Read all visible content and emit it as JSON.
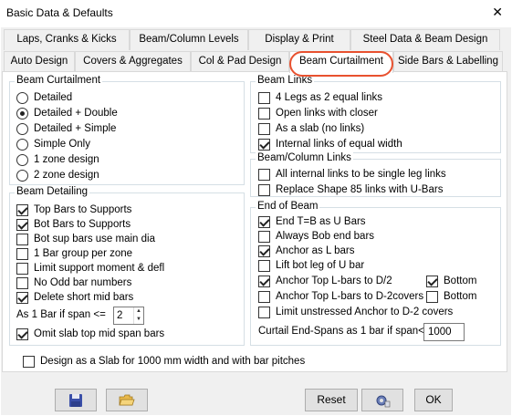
{
  "window": {
    "title": "Basic Data & Defaults",
    "close_glyph": "✕"
  },
  "tabs_row1": [
    "Laps, Cranks & Kicks",
    "Beam/Column Levels",
    "Display & Print",
    "Steel Data & Beam Design"
  ],
  "tabs_row2": [
    "Auto Design",
    "Covers & Aggregates",
    "Col & Pad Design",
    "Beam Curtailment",
    "Side Bars & Labelling"
  ],
  "active_tab": "Beam Curtailment",
  "beam_curtailment": {
    "title": "Beam Curtailment",
    "options": [
      "Detailed",
      "Detailed + Double",
      "Detailed + Simple",
      "Simple Only",
      "1 zone design",
      "2 zone design"
    ],
    "selected": "Detailed + Double"
  },
  "beam_detailing": {
    "title": "Beam Detailing",
    "items": [
      {
        "label": "Top Bars to Supports",
        "checked": true
      },
      {
        "label": "Bot Bars to Supports",
        "checked": true
      },
      {
        "label": "Bot sup bars use main dia",
        "checked": false
      },
      {
        "label": "1 Bar group per zone",
        "checked": false
      },
      {
        "label": "Limit support moment & defl",
        "checked": false
      },
      {
        "label": "No Odd bar numbers",
        "checked": false
      },
      {
        "label": "Delete short mid bars",
        "checked": true
      }
    ],
    "one_bar_label": "As 1 Bar if span <=",
    "one_bar_value": "2",
    "omit_label": "Omit slab top mid span  bars",
    "omit_checked": true
  },
  "beam_links": {
    "title": "Beam Links",
    "items": [
      {
        "label": "4 Legs as 2 equal links",
        "checked": false
      },
      {
        "label": "Open links with closer",
        "checked": false
      },
      {
        "label": "As a slab (no links)",
        "checked": false
      },
      {
        "label": "Internal links of equal width",
        "checked": true
      }
    ]
  },
  "beam_column_links": {
    "title": "Beam/Column Links",
    "items": [
      {
        "label": "All internal links to be single leg links",
        "checked": false
      },
      {
        "label": "Replace Shape 85 links with U-Bars",
        "checked": false
      }
    ]
  },
  "end_of_beam": {
    "title": "End of Beam",
    "items": [
      {
        "label": "End T=B as U Bars",
        "checked": true
      },
      {
        "label": "Always Bob end bars",
        "checked": false
      },
      {
        "label": "Anchor as L bars",
        "checked": true
      },
      {
        "label": "Lift bot leg of U bar",
        "checked": false
      },
      {
        "label": "Anchor Top L-bars to D/2",
        "checked": true
      },
      {
        "label": "Anchor Top L-bars to D-2covers",
        "checked": false
      },
      {
        "label": "Limit unstressed Anchor to D-2 covers",
        "checked": false
      }
    ],
    "bottom_1": {
      "label": "Bottom",
      "checked": true
    },
    "bottom_2": {
      "label": "Bottom",
      "checked": false
    },
    "curtail_label": "Curtail End-Spans as 1 bar if span<=",
    "curtail_value": "1000"
  },
  "slab_design": {
    "label": "Design as a Slab for 1000 mm width and with bar pitches",
    "checked": false
  },
  "buttons": {
    "save_icon": "save-icon",
    "open_icon": "open-folder-icon",
    "reset": "Reset",
    "settings_icon": "settings-icon",
    "ok": "OK"
  }
}
